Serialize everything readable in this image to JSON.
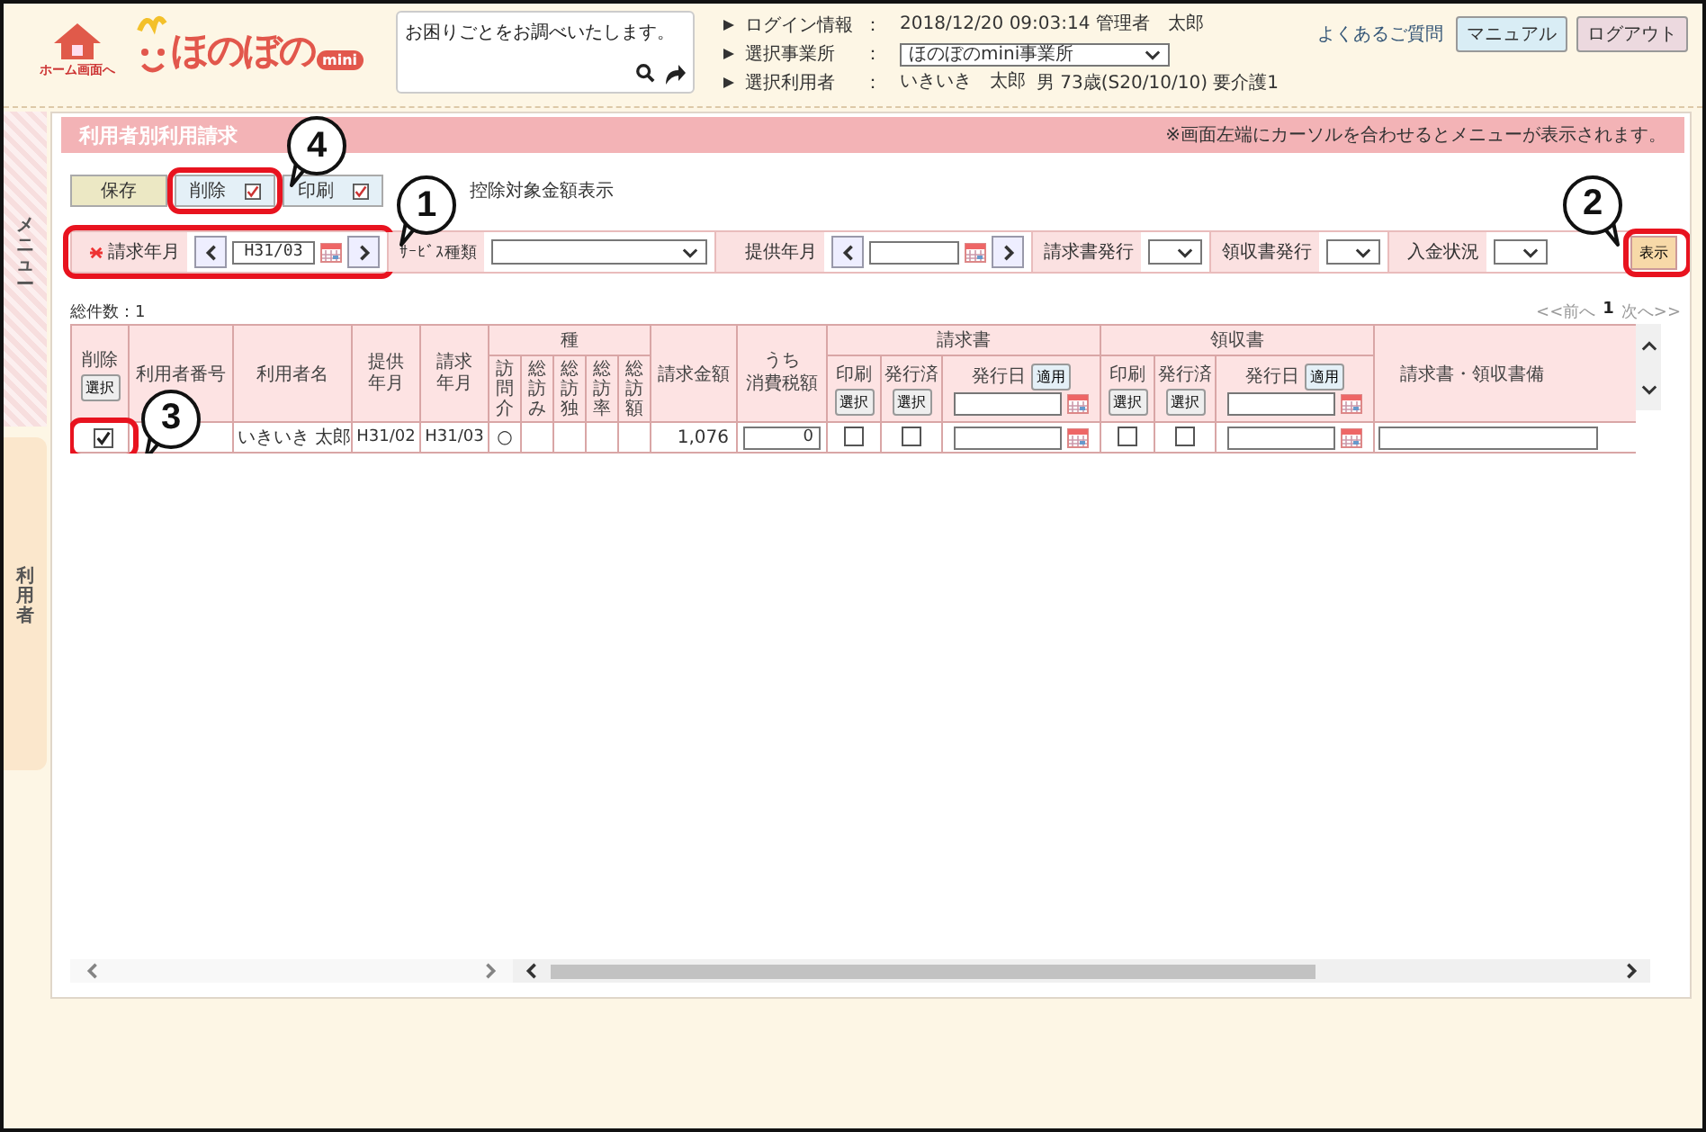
{
  "header": {
    "home_label": "ホーム画面へ",
    "logo_text": "ほのぼの",
    "logo_badge": "mini",
    "help_text": "お困りごとをお調べいたします。",
    "info": [
      {
        "label": "ログイン情報",
        "separator": "：",
        "kind": "text",
        "value": "2018/12/20 09:03:14 管理者　太郎"
      },
      {
        "label": "選択事業所",
        "separator": "：",
        "kind": "select",
        "value": "ほのぼのmini事業所"
      },
      {
        "label": "選択利用者",
        "separator": "：",
        "kind": "text",
        "value": "いきいき　太郎",
        "extra": "男 73歳(S20/10/10) 要介護1"
      }
    ],
    "faq_link": "よくあるご質問",
    "buttons": [
      {
        "label": "マニュアル",
        "kind": "manual"
      },
      {
        "label": "ログアウト",
        "kind": "logout"
      }
    ]
  },
  "side_tabs": [
    {
      "label": "メニュー",
      "kind": "menu"
    },
    {
      "label": "利用者",
      "kind": "user"
    }
  ],
  "page_title": "利用者別利用請求",
  "notice": "※画面左端にカーソルを合わせるとメニューが表示されます。",
  "toolbar": {
    "buttons": [
      {
        "label": "保存",
        "kind": "save",
        "has_checkbox": false
      },
      {
        "label": "削除",
        "kind": "delete",
        "has_checkbox": true,
        "callout": "4"
      },
      {
        "label": "印刷",
        "kind": "print",
        "has_checkbox": true
      }
    ],
    "option_label": "控除対象金額表示"
  },
  "filters": [
    {
      "kind": "month",
      "label": "請求年月",
      "required": true,
      "value": "H31/03",
      "callout": "1"
    },
    {
      "kind": "wide-select",
      "label": "ｻｰﾋﾞｽ種類"
    },
    {
      "kind": "month",
      "label": "提供年月",
      "required": false
    },
    {
      "kind": "select",
      "label": "請求書発行"
    },
    {
      "kind": "select",
      "label": "領収書発行"
    },
    {
      "kind": "select",
      "label": "入金状況"
    }
  ],
  "show_button": {
    "label": "表示",
    "callout": "2"
  },
  "count": "総件数：1",
  "pager": {
    "prev": "<<前へ",
    "page": "1",
    "next": "次へ>>"
  },
  "table": {
    "delete_header": "削除",
    "delete_button": "選択",
    "user_no": "利用者番号",
    "name": "利用者名",
    "service_month": "提供年月",
    "billing_month": "請求年月",
    "service_group": "種",
    "service_columns": [
      "訪問介",
      "総訪み",
      "総訪独",
      "総訪率",
      "総訪額"
    ],
    "used_mark": "○",
    "amount": "請求金額",
    "tax": [
      "うち",
      "消費税額"
    ],
    "doc_groups": [
      {
        "label": "請求書",
        "print": "印刷",
        "print_button": "選択",
        "issued": "発行済",
        "issued_button": "選択",
        "date": "発行日",
        "apply": "適用"
      },
      {
        "label": "領収書",
        "print": "印刷",
        "print_button": "選択",
        "issued": "発行済",
        "issued_button": "選択",
        "date": "発行日",
        "apply": "適用"
      }
    ],
    "remarks": "請求書・領収書備",
    "rows": [
      {
        "delete_checked": true,
        "callout": "3",
        "name": "いきいき 太郎",
        "service_month": "H31/02",
        "billing_month": "H31/03",
        "services": [
          {
            "used": true
          },
          {
            "used": false
          },
          {
            "used": false
          },
          {
            "used": false
          },
          {
            "used": false
          }
        ],
        "amount": "1,076",
        "tax": "0",
        "docs": [
          {
            "print": false,
            "issued": false
          },
          {
            "print": false,
            "issued": false
          }
        ]
      }
    ]
  }
}
